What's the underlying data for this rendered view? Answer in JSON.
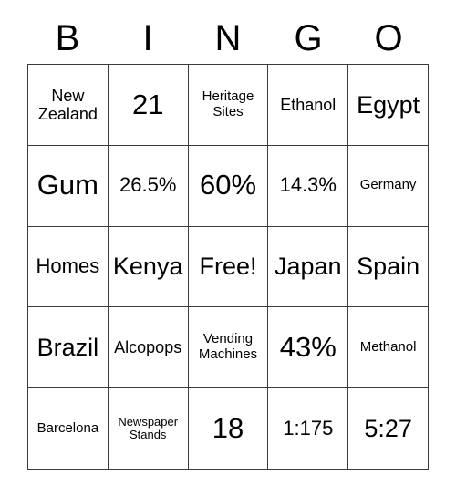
{
  "card": {
    "header_letters": [
      "B",
      "I",
      "N",
      "G",
      "O"
    ],
    "columns": 5,
    "rows": 5,
    "border_color": "#3a3a3a",
    "background_color": "#ffffff",
    "text_color": "#000000",
    "free_space_label": "Free!",
    "free_space_position": "row3-col3",
    "cells": [
      {
        "text": "New Zealand",
        "size": "sm",
        "row": 1,
        "col": 1
      },
      {
        "text": "21",
        "size": "xl",
        "row": 1,
        "col": 2
      },
      {
        "text": "Heritage Sites",
        "size": "xs",
        "row": 1,
        "col": 3
      },
      {
        "text": "Ethanol",
        "size": "sm",
        "row": 1,
        "col": 4
      },
      {
        "text": "Egypt",
        "size": "lg",
        "row": 1,
        "col": 5
      },
      {
        "text": "Gum",
        "size": "xl",
        "row": 2,
        "col": 1
      },
      {
        "text": "26.5%",
        "size": "md",
        "row": 2,
        "col": 2
      },
      {
        "text": "60%",
        "size": "xl",
        "row": 2,
        "col": 3
      },
      {
        "text": "14.3%",
        "size": "md",
        "row": 2,
        "col": 4
      },
      {
        "text": "Germany",
        "size": "xs",
        "row": 2,
        "col": 5
      },
      {
        "text": "Homes",
        "size": "md",
        "row": 3,
        "col": 1
      },
      {
        "text": "Kenya",
        "size": "lg",
        "row": 3,
        "col": 2
      },
      {
        "text": "Free!",
        "size": "lg",
        "row": 3,
        "col": 3
      },
      {
        "text": "Japan",
        "size": "lg",
        "row": 3,
        "col": 4
      },
      {
        "text": "Spain",
        "size": "lg",
        "row": 3,
        "col": 5
      },
      {
        "text": "Brazil",
        "size": "lg",
        "row": 4,
        "col": 1
      },
      {
        "text": "Alcopops",
        "size": "sm",
        "row": 4,
        "col": 2
      },
      {
        "text": "Vending Machines",
        "size": "xs",
        "row": 4,
        "col": 3
      },
      {
        "text": "43%",
        "size": "xl",
        "row": 4,
        "col": 4
      },
      {
        "text": "Methanol",
        "size": "xs",
        "row": 4,
        "col": 5
      },
      {
        "text": "Barcelona",
        "size": "xs",
        "row": 5,
        "col": 1
      },
      {
        "text": "Newspaper Stands",
        "size": "xxs",
        "row": 5,
        "col": 2
      },
      {
        "text": "18",
        "size": "xl",
        "row": 5,
        "col": 3
      },
      {
        "text": "1:175",
        "size": "md",
        "row": 5,
        "col": 4
      },
      {
        "text": "5:27",
        "size": "lg",
        "row": 5,
        "col": 5
      }
    ]
  }
}
